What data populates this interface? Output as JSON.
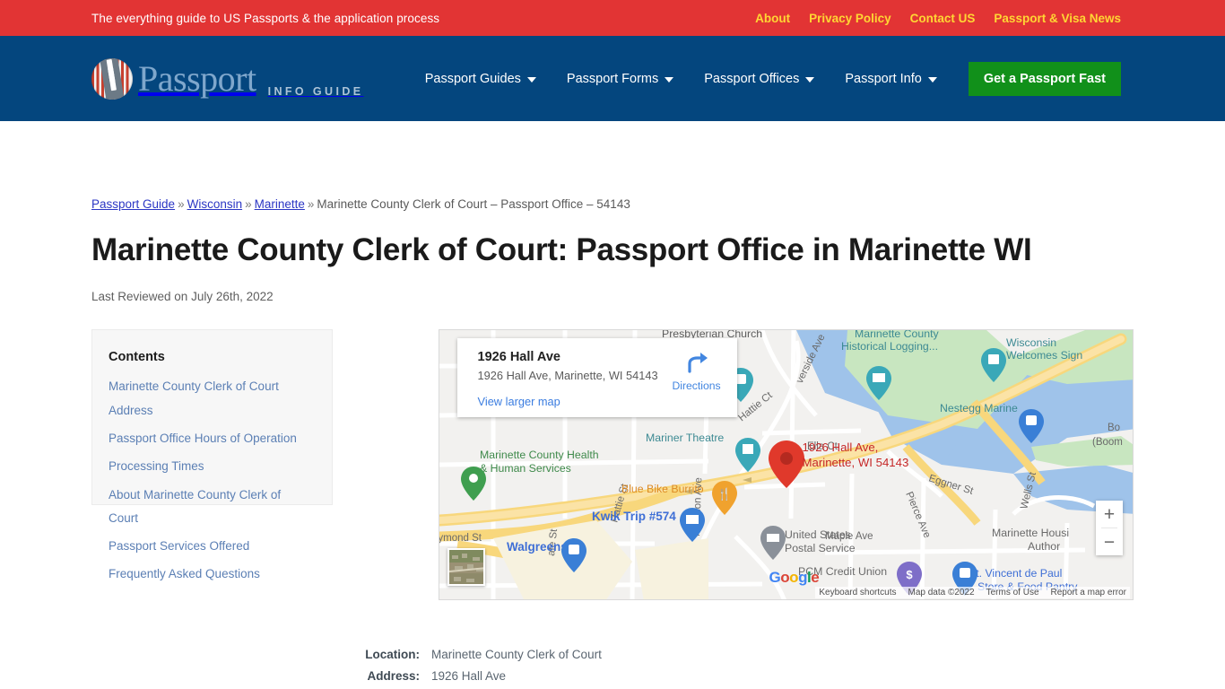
{
  "topbar": {
    "tagline": "The everything guide to US Passports & the application process",
    "links": [
      {
        "label": "About"
      },
      {
        "label": "Privacy Policy"
      },
      {
        "label": "Contact US"
      },
      {
        "label": "Passport & Visa News"
      }
    ],
    "bg_color": "#e23434",
    "link_color": "#ffd633"
  },
  "header": {
    "brand_word": "Passport",
    "brand_sub": "INFO GUIDE",
    "bg_color": "#04467e",
    "nav": [
      {
        "label": "Passport Guides",
        "has_caret": true
      },
      {
        "label": "Passport Forms",
        "has_caret": true
      },
      {
        "label": "Passport Offices",
        "has_caret": true
      },
      {
        "label": "Passport Info",
        "has_caret": true
      }
    ],
    "cta_label": "Get a Passport Fast",
    "cta_color": "#11901a"
  },
  "breadcrumb": {
    "items": [
      {
        "label": "Passport Guide",
        "link": true
      },
      {
        "label": "Wisconsin",
        "link": true
      },
      {
        "label": "Marinette",
        "link": true
      },
      {
        "label": "Marinette County Clerk of Court – Passport Office – 54143",
        "link": false
      }
    ],
    "separator": "»"
  },
  "page": {
    "title": "Marinette County Clerk of Court: Passport Office in Marinette WI",
    "reviewed": "Last Reviewed on July 26th, 2022"
  },
  "contents": {
    "title": "Contents",
    "items": [
      {
        "label": "Marinette County Clerk of Court Address"
      },
      {
        "label": "Passport Office Hours of Operation"
      },
      {
        "label": "Processing Times"
      },
      {
        "label": "About Marinette County Clerk of Court"
      },
      {
        "label": "Passport Services Offered"
      },
      {
        "label": "Frequently Asked Questions"
      }
    ]
  },
  "map": {
    "card": {
      "title": "1926 Hall Ave",
      "address": "1926 Hall Ave, Marinette, WI 54143",
      "view_larger": "View larger map",
      "directions_label": "Directions"
    },
    "marker_label_line1": "1926 Hall Ave,",
    "marker_label_line2": "Marinette, WI 54143",
    "zoom_in": "+",
    "zoom_out": "−",
    "attribution": [
      "Keyboard shortcuts",
      "Map data ©2022",
      "Terms of Use",
      "Report a map error"
    ],
    "google_logo": "Google",
    "poi_labels": [
      "Presbyterian Church",
      "Marinette County Historical Logging...",
      "Wisconsin Welcomes Sign",
      "Nestegg Marine",
      "Mariner Theatre",
      "Marinette County Health & Human Services",
      "Blue Bike Burrito",
      "Kwik Trip #574",
      "Walgreens",
      "United States Postal Service",
      "PCM Credit Union",
      "St. Vincent de Paul Store & Food Pantry",
      "Marinette Housing Authority"
    ],
    "street_labels": [
      "Riverside Ave",
      "Hattie Ct",
      "Hattie St",
      "Ella Ct",
      "Eggner St",
      "Wells St",
      "Pierce Ave",
      "Madison Ave",
      "Maple Ave",
      "Raymond St",
      "State St",
      "Bo (Boom"
    ]
  },
  "info": {
    "rows": [
      {
        "label": "Location:",
        "value": "Marinette County Clerk of Court"
      },
      {
        "label": "Address:",
        "value": "1926 Hall Ave"
      }
    ]
  }
}
